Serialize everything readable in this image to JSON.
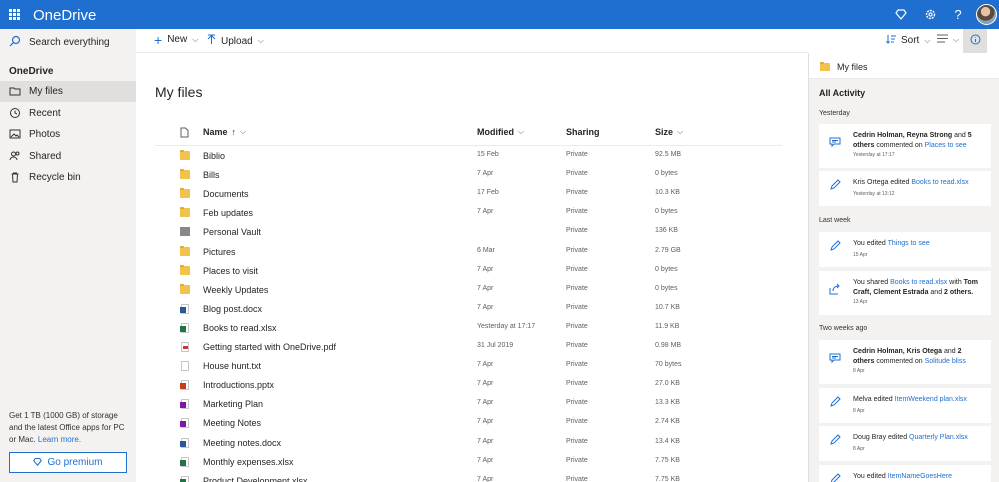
{
  "app": {
    "title": "OneDrive"
  },
  "colors": {
    "accent": "#1f6fd1",
    "sidebar_bg": "#f3f2f1",
    "folder": "#f2c34c"
  },
  "search": {
    "placeholder": "Search everything"
  },
  "sidebar": {
    "header": "OneDrive",
    "items": [
      {
        "label": "My files",
        "icon": "folder-icon",
        "active": true
      },
      {
        "label": "Recent",
        "icon": "clock-icon"
      },
      {
        "label": "Photos",
        "icon": "image-icon"
      },
      {
        "label": "Shared",
        "icon": "people-icon"
      },
      {
        "label": "Recycle bin",
        "icon": "trash-icon"
      }
    ],
    "promo_text": "Get 1 TB (1000 GB) of storage and the latest Office apps for PC or Mac.",
    "promo_link": "Learn more.",
    "premium_label": "Go premium"
  },
  "toolbar": {
    "new_label": "New",
    "upload_label": "Upload",
    "sort_label": "Sort"
  },
  "main": {
    "title": "My files",
    "columns": {
      "name": "Name",
      "name_sort": "↑",
      "modified": "Modified",
      "sharing": "Sharing",
      "size": "Size"
    },
    "files": [
      {
        "name": "Biblio",
        "type": "folder",
        "modified": "15 Feb",
        "sharing": "Private",
        "size": "92.5 MB"
      },
      {
        "name": "Bills",
        "type": "folder",
        "modified": "7 Apr",
        "sharing": "Private",
        "size": "0 bytes"
      },
      {
        "name": "Documents",
        "type": "folder",
        "modified": "17 Feb",
        "sharing": "Private",
        "size": "10.3 KB"
      },
      {
        "name": "Feb updates",
        "type": "folder",
        "modified": "7 Apr",
        "sharing": "Private",
        "size": "0 bytes"
      },
      {
        "name": "Personal Vault",
        "type": "vault",
        "modified": "",
        "sharing": "Private",
        "size": "136 KB"
      },
      {
        "name": "Pictures",
        "type": "folder",
        "modified": "6 Mar",
        "sharing": "Private",
        "size": "2.79 GB"
      },
      {
        "name": "Places to visit",
        "type": "folder",
        "modified": "7 Apr",
        "sharing": "Private",
        "size": "0 bytes"
      },
      {
        "name": "Weekly Updates",
        "type": "folder",
        "modified": "7 Apr",
        "sharing": "Private",
        "size": "0 bytes"
      },
      {
        "name": "Blog post.docx",
        "type": "word",
        "modified": "7 Apr",
        "sharing": "Private",
        "size": "10.7 KB"
      },
      {
        "name": "Books to read.xlsx",
        "type": "excel",
        "modified": "Yesterday at 17:17",
        "sharing": "Private",
        "size": "11.9 KB"
      },
      {
        "name": "Getting started with OneDrive.pdf",
        "type": "pdf",
        "modified": "31 Jul 2019",
        "sharing": "Private",
        "size": "0.98 MB"
      },
      {
        "name": "House hunt.txt",
        "type": "txt",
        "modified": "7 Apr",
        "sharing": "Private",
        "size": "70 bytes"
      },
      {
        "name": "Introductions.pptx",
        "type": "ppt",
        "modified": "7 Apr",
        "sharing": "Private",
        "size": "27.0 KB"
      },
      {
        "name": "Marketing Plan",
        "type": "one",
        "modified": "7 Apr",
        "sharing": "Private",
        "size": "13.3 KB"
      },
      {
        "name": "Meeting Notes",
        "type": "one",
        "modified": "7 Apr",
        "sharing": "Private",
        "size": "2.74 KB"
      },
      {
        "name": "Meeting notes.docx",
        "type": "word",
        "modified": "7 Apr",
        "sharing": "Private",
        "size": "13.4 KB"
      },
      {
        "name": "Monthly expenses.xlsx",
        "type": "excel",
        "modified": "7 Apr",
        "sharing": "Private",
        "size": "7.75 KB"
      },
      {
        "name": "Product Development.xlsx",
        "type": "excel",
        "modified": "7 Apr",
        "sharing": "Private",
        "size": "7.75 KB"
      }
    ]
  },
  "panel": {
    "title": "My files",
    "activity_header": "All Activity",
    "groups": [
      {
        "label": "Yesterday"
      },
      {
        "label": "Last week"
      },
      {
        "label": "Two weeks ago"
      }
    ],
    "cards": [
      {
        "icon": "comment-icon",
        "parts": [
          [
            "Cedrin Holman, Reyna Strong",
            "b"
          ],
          [
            " and ",
            ""
          ],
          [
            "5 others",
            "b"
          ],
          [
            " commented on ",
            ""
          ],
          [
            "Places to see",
            "lnk"
          ]
        ],
        "time": "Yesterday at 17:17"
      },
      {
        "icon": "edit-icon",
        "parts": [
          [
            "Kris Ortega",
            ""
          ],
          [
            " edited ",
            ""
          ],
          [
            "Books to read.xlsx",
            "lnk"
          ]
        ],
        "time": "Yesterday at 13:12"
      },
      {
        "icon": "edit-icon",
        "parts": [
          [
            "You",
            ""
          ],
          [
            " edited ",
            ""
          ],
          [
            "Things to see",
            "lnk"
          ]
        ],
        "time": "15 Apr"
      },
      {
        "icon": "share-icon",
        "parts": [
          [
            "You",
            ""
          ],
          [
            " shared ",
            ""
          ],
          [
            "Books to read.xlsx",
            "lnk"
          ],
          [
            " with ",
            ""
          ],
          [
            "Tom Craft, Clement Estrada",
            "b"
          ],
          [
            " and ",
            ""
          ],
          [
            "2 others.",
            "b"
          ]
        ],
        "time": "13 Apr"
      },
      {
        "icon": "comment-icon",
        "parts": [
          [
            "Cedrin Holman, Kris Otega",
            "b"
          ],
          [
            " and ",
            ""
          ],
          [
            "2 others",
            "b"
          ],
          [
            " commented on ",
            ""
          ],
          [
            "Solitude bliss",
            "lnk"
          ]
        ],
        "time": "8 Apr"
      },
      {
        "icon": "edit-icon",
        "parts": [
          [
            "Melva",
            ""
          ],
          [
            " edited ",
            ""
          ],
          [
            "ItemWeekend plan.xlsx",
            "lnk"
          ]
        ],
        "time": "8 Apr"
      },
      {
        "icon": "edit-icon",
        "parts": [
          [
            "Doug Bray",
            ""
          ],
          [
            " edited ",
            ""
          ],
          [
            "Quarterly Plan.xlsx",
            "lnk"
          ]
        ],
        "time": "8 Apr"
      },
      {
        "icon": "edit-icon",
        "parts": [
          [
            "You",
            ""
          ],
          [
            " edited ",
            ""
          ],
          [
            "ItemNameGoesHere",
            "lnk"
          ]
        ],
        "time": ""
      }
    ]
  }
}
